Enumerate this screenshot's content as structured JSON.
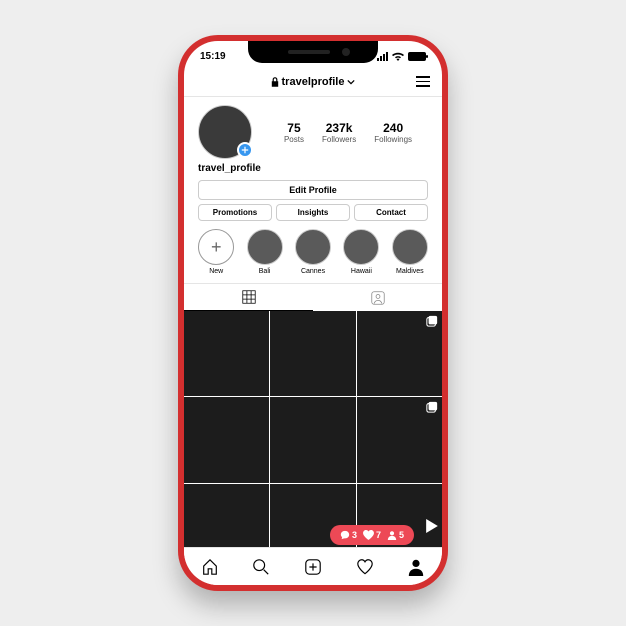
{
  "status": {
    "time": "15:19"
  },
  "topbar": {
    "username": "travelprofile"
  },
  "profile": {
    "username": "travel_profile",
    "stats": {
      "posts": {
        "count": "75",
        "label": "Posts"
      },
      "followers": {
        "count": "237k",
        "label": "Followers"
      },
      "followings": {
        "count": "240",
        "label": "Followings"
      }
    },
    "edit": "Edit Profile",
    "buttons": {
      "promotions": "Promotions",
      "insights": "Insights",
      "contact": "Contact"
    },
    "highlights": {
      "new": "New",
      "bali": "Bali",
      "cannes": "Cannes",
      "hawaii": "Hawaii",
      "maldives": "Maldives"
    }
  },
  "toast": {
    "comments": "3",
    "likes": "7",
    "follows": "5"
  }
}
